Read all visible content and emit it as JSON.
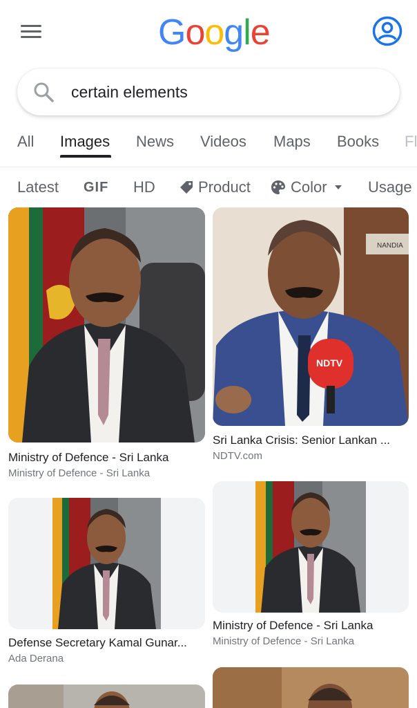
{
  "header": {
    "logo_letters": [
      "G",
      "o",
      "o",
      "g",
      "l",
      "e"
    ],
    "colors": {
      "blue": "#4285F4",
      "red": "#EA4335",
      "yellow": "#FBBC05",
      "green": "#34A853"
    }
  },
  "search": {
    "query": "certain elements"
  },
  "tabs": [
    {
      "label": "All"
    },
    {
      "label": "Images",
      "active": true
    },
    {
      "label": "News"
    },
    {
      "label": "Videos"
    },
    {
      "label": "Maps"
    },
    {
      "label": "Books"
    },
    {
      "label": "Fl"
    }
  ],
  "chips": [
    {
      "label": "Latest"
    },
    {
      "label": "GIF"
    },
    {
      "label": "HD"
    },
    {
      "label": "Product",
      "icon": "tag-icon"
    },
    {
      "label": "Color",
      "icon": "palette-icon"
    },
    {
      "label": "Usage"
    }
  ],
  "results": [
    {
      "title": "Ministry of Defence - Sri Lanka",
      "source": "Ministry of Defence - Sri Lanka"
    },
    {
      "title": "Sri Lanka Crisis: Senior Lankan ...",
      "source": "NDTV.com",
      "mic_text": "NDTV",
      "sign_text": "NANDIA"
    },
    {
      "title": "Defense Secretary Kamal Gunar...",
      "source": "Ada Derana"
    },
    {
      "title": "Ministry of Defence - Sri Lanka",
      "source": "Ministry of Defence - Sri Lanka"
    },
    {
      "title": "",
      "source": ""
    },
    {
      "title": "",
      "source": ""
    }
  ]
}
